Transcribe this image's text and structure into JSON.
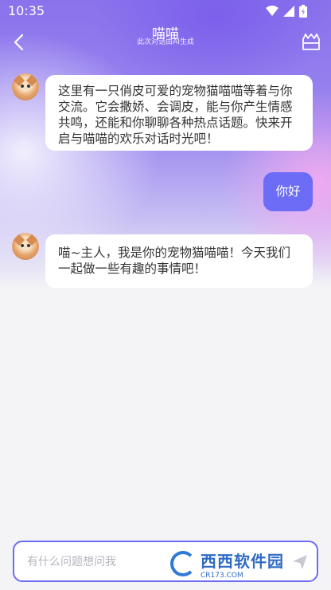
{
  "status_bar": {
    "time": "10:35"
  },
  "header": {
    "title": "喵喵",
    "subtitle": "此次对话由AI生成"
  },
  "messages": [
    {
      "role": "assistant",
      "text": "这里有一只俏皮可爱的宠物猫喵喵等着与你交流。它会撒娇、会调皮，能与你产生情感共鸣，还能和你聊聊各种热点话题。快来开启与喵喵的欢乐对话时光吧！"
    },
    {
      "role": "user",
      "text": "你好"
    },
    {
      "role": "assistant",
      "text": "喵~主人，我是你的宠物猫喵喵！今天我们一起做一些有趣的事情吧！"
    }
  ],
  "input": {
    "placeholder": "有什么问题想问我"
  },
  "watermark": {
    "brand": "西西软件园",
    "domain": "CR173.COM"
  },
  "colors": {
    "accent": "#6c6cf6",
    "background": "#f4f4f6"
  }
}
